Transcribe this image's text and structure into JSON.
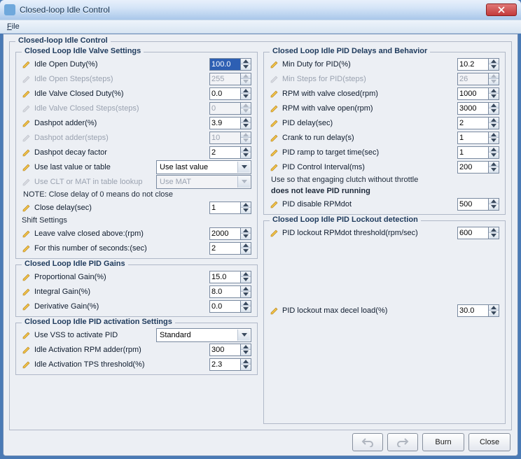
{
  "window": {
    "title": "Closed-loop Idle Control"
  },
  "menu": {
    "file": "File"
  },
  "outer_legend": "Closed-loop Idle Control",
  "left": {
    "valve": {
      "legend": "Closed Loop Idle Valve Settings",
      "idle_open_duty": {
        "label": "Idle Open Duty(%)",
        "value": "100.0"
      },
      "idle_open_steps": {
        "label": "Idle Open Steps(steps)",
        "value": "255"
      },
      "idle_closed_duty": {
        "label": "Idle Valve Closed Duty(%)",
        "value": "0.0"
      },
      "idle_closed_steps": {
        "label": "Idle Valve Closed Steps(steps)",
        "value": "0"
      },
      "dashpot_adder_pct": {
        "label": "Dashpot adder(%)",
        "value": "3.9"
      },
      "dashpot_adder_steps": {
        "label": "Dashpot adder(steps)",
        "value": "10"
      },
      "dashpot_decay": {
        "label": "Dashpot decay factor",
        "value": "2"
      },
      "use_last": {
        "label": "Use last value or table",
        "selected": "Use last value"
      },
      "clt_mat": {
        "label": "Use CLT or MAT in table lookup",
        "selected": "Use MAT"
      },
      "note": "NOTE: Close delay of 0 means do not close",
      "close_delay": {
        "label": "Close delay(sec)",
        "value": "1"
      },
      "shift_head": "Shift Settings",
      "leave_valve": {
        "label": "Leave valve closed above:(rpm)",
        "value": "2000"
      },
      "for_seconds": {
        "label": "For this number of seconds:(sec)",
        "value": "2"
      }
    },
    "gains": {
      "legend": "Closed Loop Idle PID Gains",
      "prop": {
        "label": "Proportional Gain(%)",
        "value": "15.0"
      },
      "integ": {
        "label": "Integral Gain(%)",
        "value": "8.0"
      },
      "deriv": {
        "label": "Derivative Gain(%)",
        "value": "0.0"
      }
    },
    "activation": {
      "legend": "Closed Loop Idle PID activation Settings",
      "use_vss": {
        "label": "Use VSS to activate PID",
        "selected": "Standard"
      },
      "rpm_adder": {
        "label": "Idle Activation RPM adder(rpm)",
        "value": "300"
      },
      "tps_thresh": {
        "label": "Idle Activation TPS threshold(%)",
        "value": "2.3"
      }
    }
  },
  "right": {
    "delays": {
      "legend": "Closed Loop Idle PID Delays and Behavior",
      "min_duty": {
        "label": "Min Duty for PID(%)",
        "value": "10.2"
      },
      "min_steps": {
        "label": "Min Steps for PID(steps)",
        "value": "26"
      },
      "rpm_closed": {
        "label": "RPM with valve closed(rpm)",
        "value": "1000"
      },
      "rpm_open": {
        "label": "RPM with valve open(rpm)",
        "value": "3000"
      },
      "pid_delay": {
        "label": "PID delay(sec)",
        "value": "2"
      },
      "crank_run": {
        "label": "Crank to run delay(s)",
        "value": "1"
      },
      "ramp_time": {
        "label": "PID ramp to target time(sec)",
        "value": "1"
      },
      "interval": {
        "label": "PID Control Interval(ms)",
        "value": "200"
      },
      "note1": "Use so that engaging clutch without throttle",
      "note2": "does not leave PID running",
      "disable_rpmdot": {
        "label": "PID disable RPMdot",
        "value": "500"
      }
    },
    "lockout": {
      "legend": "Closed Loop Idle PID Lockout detection",
      "thresh": {
        "label": "PID lockout RPMdot threshold(rpm/sec)",
        "value": "600"
      },
      "max_decel": {
        "label": "PID lockout max decel load(%)",
        "value": "30.0"
      }
    }
  },
  "footer": {
    "burn": "Burn",
    "close": "Close"
  }
}
